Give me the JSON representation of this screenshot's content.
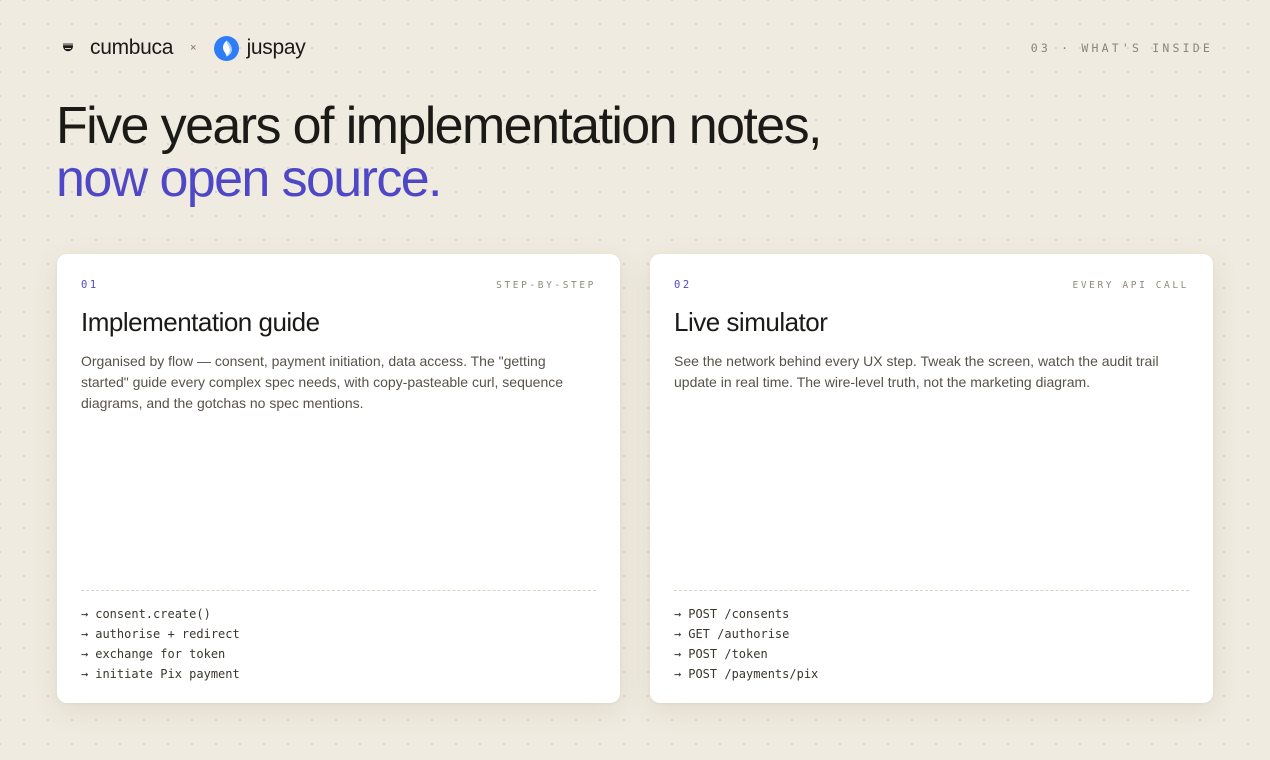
{
  "header": {
    "brand_left": "cumbuca",
    "separator": "×",
    "brand_right": "juspay",
    "section_label": "03 · WHAT'S INSIDE",
    "colors": {
      "accent": "#4f48c6",
      "juspay_blue": "#2f7df6",
      "background": "#f0ebe0"
    }
  },
  "hero": {
    "line1": "Five years of implementation notes,",
    "line2": "now open source."
  },
  "cards": [
    {
      "number": "01",
      "tag": "STEP-BY-STEP",
      "title": "Implementation guide",
      "description": "Organised by flow — consent, payment initiation, data access. The \"getting started\" guide every complex spec needs, with copy-pasteable curl, sequence diagrams, and the gotchas no spec mentions.",
      "steps": [
        "consent.create()",
        "authorise + redirect",
        "exchange for token",
        "initiate Pix payment"
      ]
    },
    {
      "number": "02",
      "tag": "EVERY API CALL",
      "title": "Live simulator",
      "description": "See the network behind every UX step. Tweak the screen, watch the audit trail update in real time. The wire-level truth, not the marketing diagram.",
      "steps": [
        "POST /consents",
        "GET /authorise",
        "POST /token",
        "POST /payments/pix"
      ]
    }
  ],
  "step_arrow": "→",
  "icons": {
    "cumbuca": "bowl-icon",
    "juspay": "juspay-logo-icon"
  }
}
